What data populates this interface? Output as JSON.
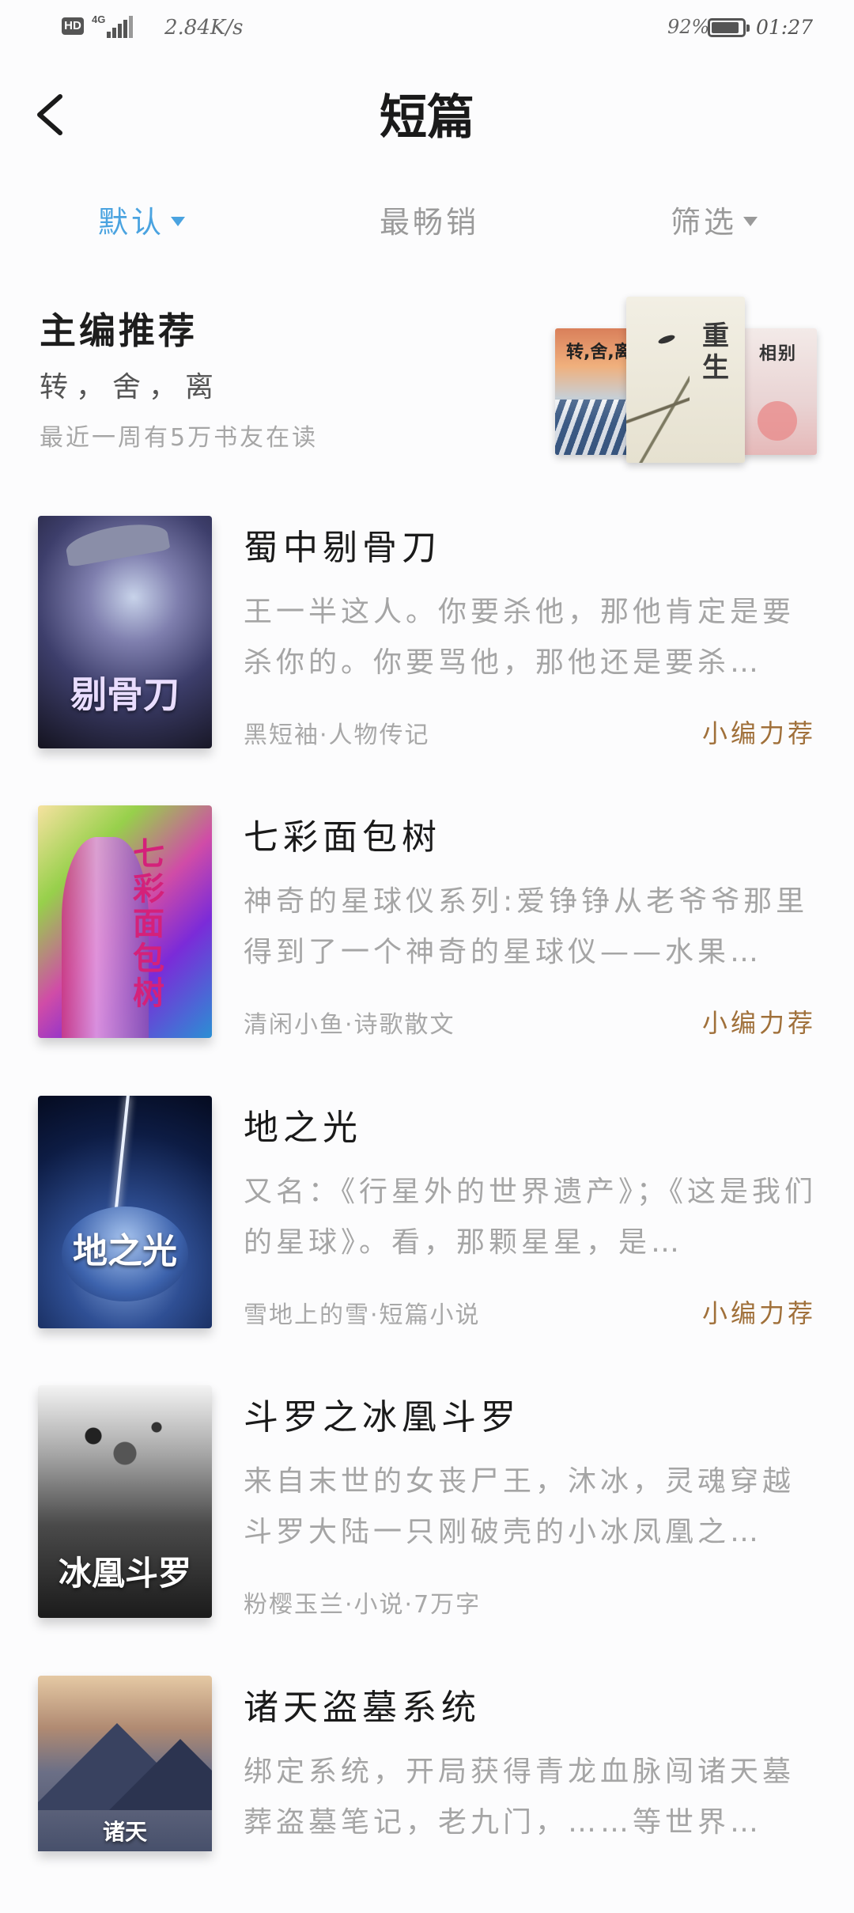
{
  "status_bar": {
    "hd": "HD",
    "network": "4G",
    "speed": "2.84K/s",
    "battery_percent": "92%",
    "time": "01:27"
  },
  "nav": {
    "back_icon": "chevron-left-icon",
    "title": "短篇"
  },
  "tabs": [
    {
      "label": "默认",
      "active": true,
      "has_arrow": true
    },
    {
      "label": "最畅销",
      "active": false,
      "has_arrow": false
    },
    {
      "label": "筛选",
      "active": false,
      "has_arrow": true
    }
  ],
  "editor_recommend": {
    "title": "主编推荐",
    "subtitle": "转，舍，离",
    "readers": "最近一周有5万书友在读",
    "cover_texts": [
      "转,舍,离",
      "重生",
      "相别"
    ]
  },
  "books": [
    {
      "title": "蜀中剔骨刀",
      "desc": "王一半这人。你要杀他，那他肯定是要杀你的。你要骂他，那他还是要杀…",
      "meta": "黑短袖·人物传记",
      "tag": "小编力荐",
      "cover_text": "剔骨刀"
    },
    {
      "title": "七彩面包树",
      "desc": "神奇的星球仪系列:爱铮铮从老爷爷那里得到了一个神奇的星球仪——水果…",
      "meta": "清闲小鱼·诗歌散文",
      "tag": "小编力荐",
      "cover_text": "七彩面包树"
    },
    {
      "title": "地之光",
      "desc": "又名：《行星外的世界遗产》；《这是我们的星球》。看，那颗星星，是…",
      "meta": "雪地上的雪·短篇小说",
      "tag": "小编力荐",
      "cover_text": "地之光"
    },
    {
      "title": "斗罗之冰凰斗罗",
      "desc": "来自末世的女丧尸王，沐冰，灵魂穿越斗罗大陆一只刚破壳的小冰凤凰之…",
      "meta": "粉樱玉兰·小说·7万字",
      "tag": "",
      "cover_text": "冰凰斗罗"
    },
    {
      "title": "诸天盗墓系统",
      "desc": "绑定系统，开局获得青龙血脉闯诸天墓葬盗墓笔记，老九门，……等世界…",
      "meta": "",
      "tag": "",
      "cover_text": "诸天"
    }
  ]
}
